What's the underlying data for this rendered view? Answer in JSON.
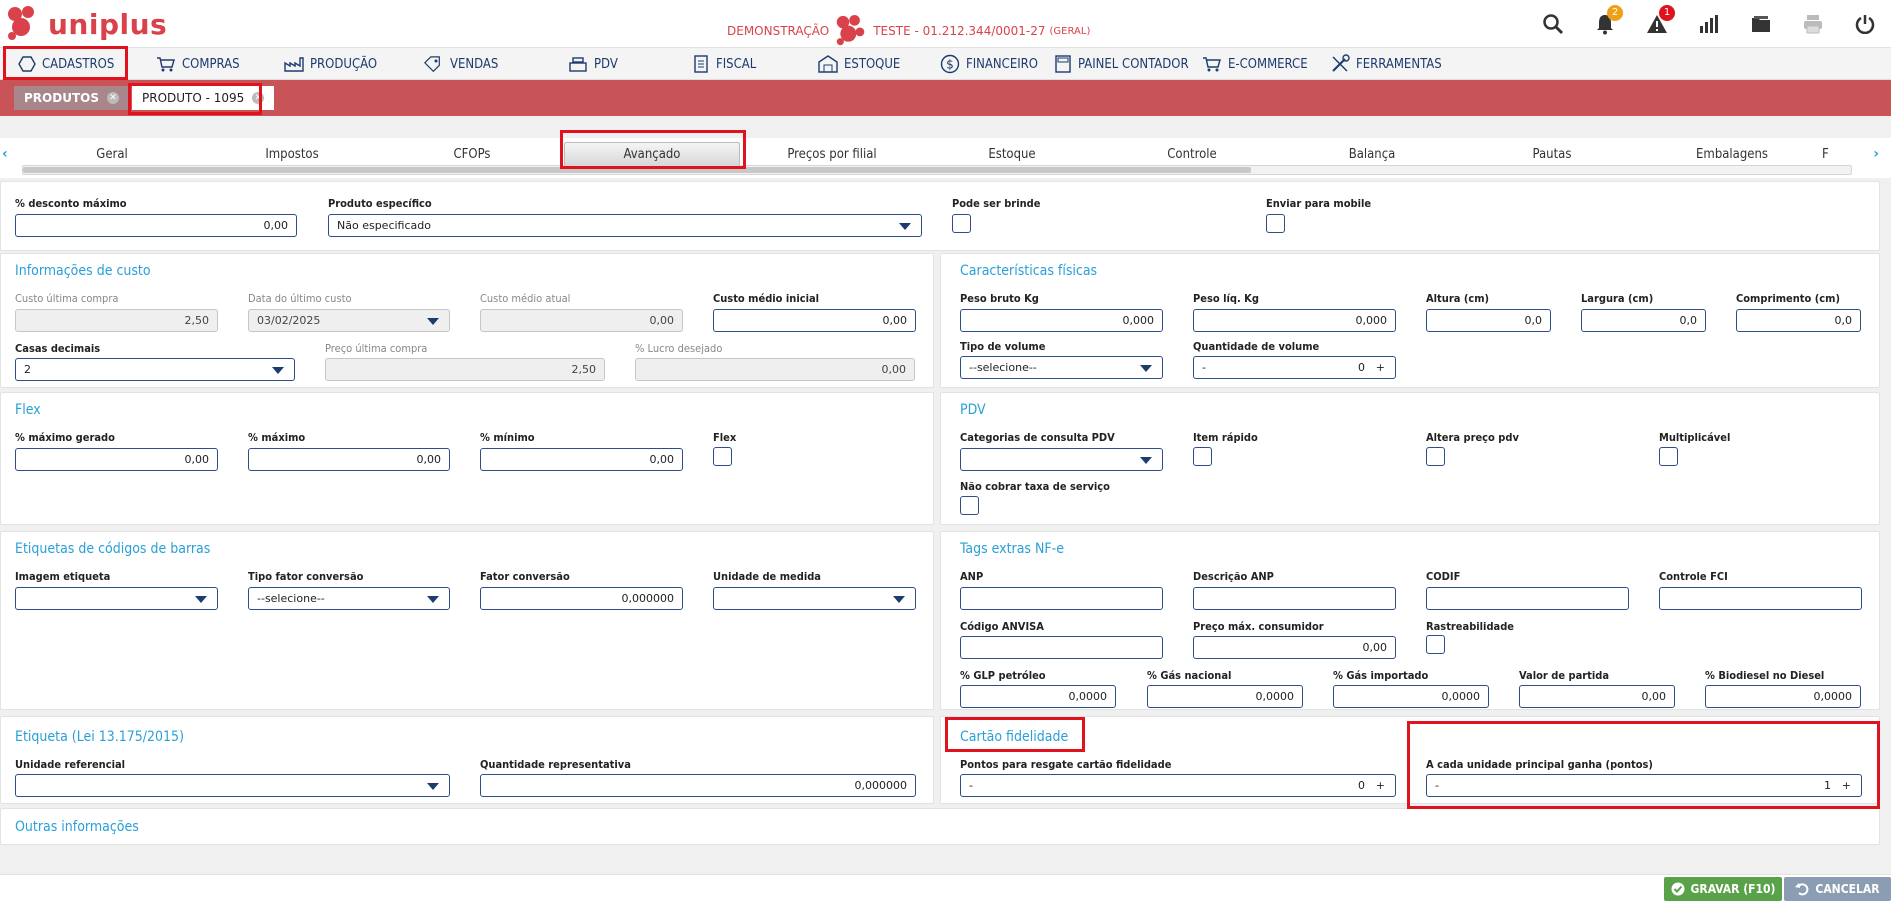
{
  "app": {
    "logo_text": "uniplus"
  },
  "header": {
    "mode": "DEMONSTRAÇÃO",
    "company": "TESTE - 01.212.344/0001-27",
    "company_tag": "(GERAL)",
    "notifications_count": "2",
    "alerts_count": "1"
  },
  "menu": {
    "items": [
      "CADASTROS",
      "COMPRAS",
      "PRODUÇÃO",
      "VENDAS",
      "PDV",
      "FISCAL",
      "ESTOQUE",
      "FINANCEIRO",
      "PAINEL CONTADOR",
      "E-COMMERCE",
      "FERRAMENTAS"
    ]
  },
  "tabs": {
    "produtos": "PRODUTOS",
    "produto": "PRODUTO - 1095"
  },
  "subtabs": [
    "Geral",
    "Impostos",
    "CFOPs",
    "Avançado",
    "Preços por filial",
    "Estoque",
    "Controle",
    "Balança",
    "Pautas",
    "Embalagens",
    "F"
  ],
  "top": {
    "desconto_label": "% desconto máximo",
    "desconto_value": "0,00",
    "prod_esp_label": "Produto específico",
    "prod_esp_value": "Não especificado",
    "brinde_label": "Pode ser brinde",
    "mobile_label": "Enviar para mobile"
  },
  "custo": {
    "title": "Informações de custo",
    "ult_compra_label": "Custo última compra",
    "ult_compra_value": "2,50",
    "data_label": "Data do último custo",
    "data_value": "03/02/2025",
    "medio_label": "Custo médio atual",
    "medio_value": "0,00",
    "medio_ini_label": "Custo médio inicial",
    "medio_ini_value": "0,00",
    "casas_label": "Casas decimais",
    "casas_value": "2",
    "preco_ult_label": "Preço última compra",
    "preco_ult_value": "2,50",
    "lucro_label": "% Lucro desejado",
    "lucro_value": "0,00"
  },
  "fisicas": {
    "title": "Características físicas",
    "peso_bruto_label": "Peso bruto Kg",
    "peso_bruto_value": "0,000",
    "peso_liq_label": "Peso líq. Kg",
    "peso_liq_value": "0,000",
    "altura_label": "Altura (cm)",
    "altura_value": "0,0",
    "largura_label": "Largura (cm)",
    "largura_value": "0,0",
    "comprimento_label": "Comprimento (cm)",
    "comprimento_value": "0,0",
    "tipo_vol_label": "Tipo de volume",
    "tipo_vol_value": "--selecione--",
    "qtd_vol_label": "Quantidade de volume",
    "qtd_vol_value": "0"
  },
  "flex": {
    "title": "Flex",
    "max_gerado_label": "% máximo gerado",
    "max_gerado_value": "0,00",
    "max_label": "% máximo",
    "max_value": "0,00",
    "min_label": "% mínimo",
    "min_value": "0,00",
    "flex_label": "Flex"
  },
  "pdv": {
    "title": "PDV",
    "categorias_label": "Categorias de consulta PDV",
    "item_rapido_label": "Item rápido",
    "altera_preco_label": "Altera preço pdv",
    "multiplicavel_label": "Multiplicável",
    "taxa_label": "Não cobrar taxa de serviço"
  },
  "etiquetas": {
    "title": "Etiquetas de códigos de barras",
    "imagem_label": "Imagem etiqueta",
    "tipo_fator_label": "Tipo fator conversão",
    "tipo_fator_value": "--selecione--",
    "fator_label": "Fator conversão",
    "fator_value": "0,000000",
    "unidade_label": "Unidade de medida"
  },
  "tags": {
    "title": "Tags extras NF-e",
    "anp_label": "ANP",
    "desc_anp_label": "Descrição ANP",
    "codif_label": "CODIF",
    "fci_label": "Controle FCI",
    "anvisa_label": "Código ANVISA",
    "preco_max_label": "Preço máx. consumidor",
    "preco_max_value": "0,00",
    "rastreab_label": "Rastreabilidade",
    "glp_label": "% GLP petróleo",
    "glp_value": "0,0000",
    "gas_nac_label": "% Gás nacional",
    "gas_nac_value": "0,0000",
    "gas_imp_label": "% Gás importado",
    "gas_imp_value": "0,0000",
    "valor_partida_label": "Valor de partida",
    "valor_partida_value": "0,00",
    "biodiesel_label": "% Biodiesel no Diesel",
    "biodiesel_value": "0,0000"
  },
  "etiqueta_lei": {
    "title": "Etiqueta (Lei 13.175/2015)",
    "unid_ref_label": "Unidade referencial",
    "qtd_rep_label": "Quantidade representativa",
    "qtd_rep_value": "0,000000"
  },
  "fidelidade": {
    "title": "Cartão fidelidade",
    "pontos_label": "Pontos para resgate cartão fidelidade",
    "pontos_value": "0",
    "cada_label": "A cada unidade principal ganha (pontos)",
    "cada_value": "1"
  },
  "outras": {
    "title": "Outras informações"
  },
  "footer": {
    "gravar": "GRAVAR (F10)",
    "cancelar": "CANCELAR"
  },
  "colors": {
    "brand": "#d9424a",
    "tabbar": "#c95457",
    "accent": "#2aa0d8",
    "save": "#5aa24a",
    "cancel": "#8b9db3",
    "highlight": "#e0121e"
  }
}
